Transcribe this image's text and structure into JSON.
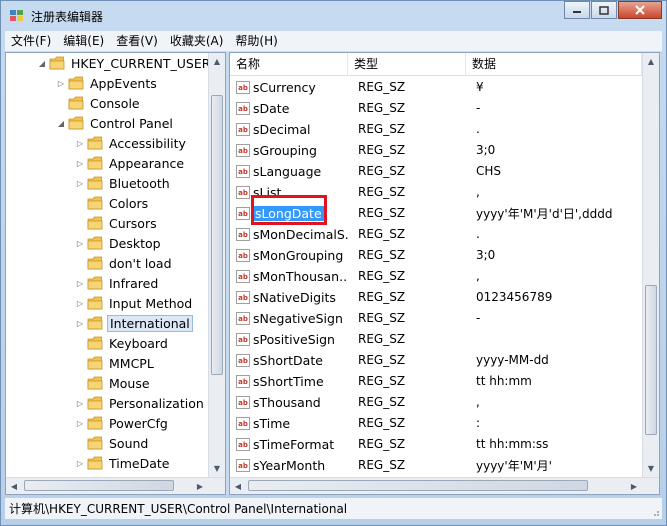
{
  "window": {
    "title": "注册表编辑器"
  },
  "menu": [
    "文件(F)",
    "编辑(E)",
    "查看(V)",
    "收藏夹(A)",
    "帮助(H)"
  ],
  "tree": [
    {
      "label": "HKEY_CURRENT_USER",
      "level": 0,
      "expander": "open"
    },
    {
      "label": "AppEvents",
      "level": 1,
      "expander": "closed"
    },
    {
      "label": "Console",
      "level": 1,
      "expander": "none"
    },
    {
      "label": "Control Panel",
      "level": 1,
      "expander": "open"
    },
    {
      "label": "Accessibility",
      "level": 2,
      "expander": "closed"
    },
    {
      "label": "Appearance",
      "level": 2,
      "expander": "closed"
    },
    {
      "label": "Bluetooth",
      "level": 2,
      "expander": "closed"
    },
    {
      "label": "Colors",
      "level": 2,
      "expander": "none"
    },
    {
      "label": "Cursors",
      "level": 2,
      "expander": "none"
    },
    {
      "label": "Desktop",
      "level": 2,
      "expander": "closed"
    },
    {
      "label": "don't load",
      "level": 2,
      "expander": "none"
    },
    {
      "label": "Infrared",
      "level": 2,
      "expander": "closed"
    },
    {
      "label": "Input Method",
      "level": 2,
      "expander": "closed"
    },
    {
      "label": "International",
      "level": 2,
      "expander": "closed",
      "selected": true
    },
    {
      "label": "Keyboard",
      "level": 2,
      "expander": "none"
    },
    {
      "label": "MMCPL",
      "level": 2,
      "expander": "none"
    },
    {
      "label": "Mouse",
      "level": 2,
      "expander": "none"
    },
    {
      "label": "Personalization",
      "level": 2,
      "expander": "closed"
    },
    {
      "label": "PowerCfg",
      "level": 2,
      "expander": "closed"
    },
    {
      "label": "Sound",
      "level": 2,
      "expander": "none"
    },
    {
      "label": "TimeDate",
      "level": 2,
      "expander": "closed"
    }
  ],
  "list": {
    "headers": {
      "name": "名称",
      "type": "类型",
      "data": "数据"
    },
    "rows": [
      {
        "name": "sCurrency",
        "type": "REG_SZ",
        "data": "¥"
      },
      {
        "name": "sDate",
        "type": "REG_SZ",
        "data": "-"
      },
      {
        "name": "sDecimal",
        "type": "REG_SZ",
        "data": "."
      },
      {
        "name": "sGrouping",
        "type": "REG_SZ",
        "data": "3;0"
      },
      {
        "name": "sLanguage",
        "type": "REG_SZ",
        "data": "CHS"
      },
      {
        "name": "sList",
        "type": "REG_SZ",
        "data": ","
      },
      {
        "name": "sLongDate",
        "type": "REG_SZ",
        "data": "yyyy'年'M'月'd'日',dddd",
        "selected": true
      },
      {
        "name": "sMonDecimalS...",
        "type": "REG_SZ",
        "data": "."
      },
      {
        "name": "sMonGrouping",
        "type": "REG_SZ",
        "data": "3;0"
      },
      {
        "name": "sMonThousan...",
        "type": "REG_SZ",
        "data": ","
      },
      {
        "name": "sNativeDigits",
        "type": "REG_SZ",
        "data": "0123456789"
      },
      {
        "name": "sNegativeSign",
        "type": "REG_SZ",
        "data": "-"
      },
      {
        "name": "sPositiveSign",
        "type": "REG_SZ",
        "data": ""
      },
      {
        "name": "sShortDate",
        "type": "REG_SZ",
        "data": "yyyy-MM-dd"
      },
      {
        "name": "sShortTime",
        "type": "REG_SZ",
        "data": "tt hh:mm"
      },
      {
        "name": "sThousand",
        "type": "REG_SZ",
        "data": ","
      },
      {
        "name": "sTime",
        "type": "REG_SZ",
        "data": ":"
      },
      {
        "name": "sTimeFormat",
        "type": "REG_SZ",
        "data": "tt hh:mm:ss"
      },
      {
        "name": "sYearMonth",
        "type": "REG_SZ",
        "data": "yyyy'年'M'月'"
      }
    ]
  },
  "status": {
    "path": "计算机\\HKEY_CURRENT_USER\\Control Panel\\International"
  },
  "icons": {
    "value_icon": "ab"
  },
  "colors": {
    "selection": "#3399ff",
    "highlight_box": "#e0141e",
    "folder": "#e8b53a"
  }
}
